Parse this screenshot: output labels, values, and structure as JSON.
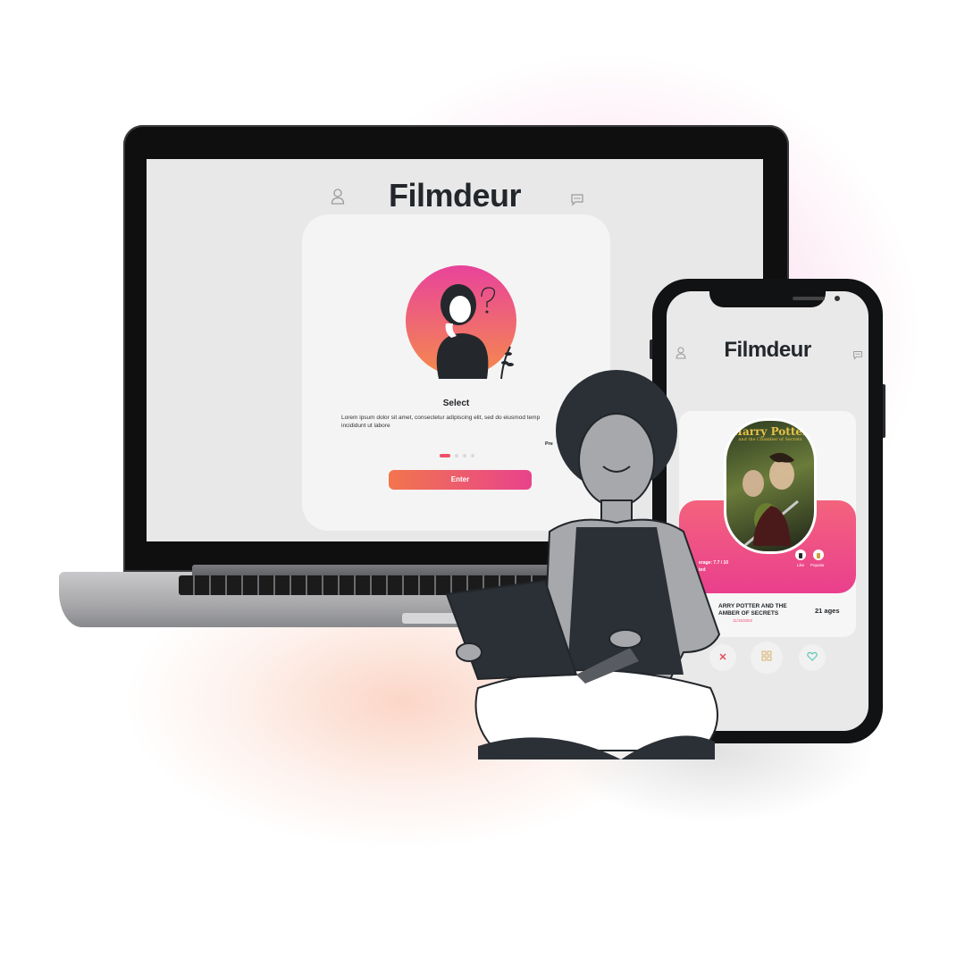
{
  "colors": {
    "accent_start": "#f2754e",
    "accent_end": "#e8438b",
    "dot_active": "#ef5066",
    "title_dark": "#23272b"
  },
  "laptop": {
    "app_title": "Filmdeur",
    "icons": {
      "left": "user-icon",
      "right": "chat-icon"
    },
    "card": {
      "heading": "Select",
      "body_line1": "Lorem ipsum dolor sit amet, consectetur adipiscing elit, sed do eiusmod temp",
      "body_line2": "incididunt ut labore",
      "prev_label": "Pre",
      "page_dots": {
        "count": 4,
        "active_index": 0
      },
      "enter_button": "Enter"
    }
  },
  "phone": {
    "app_title": "Filmdeur",
    "icons": {
      "left": "user-icon",
      "right": "chat-icon"
    },
    "movie_card": {
      "poster_title": "Harry Potter",
      "poster_subtitle": "and the Chamber of Secrets",
      "average_label": "erage: 7.7 / 10",
      "rated_label": "ted",
      "like_label": "Like",
      "popular_label": "Popular",
      "movie_title_line1": "ARRY POTTER AND THE",
      "movie_title_line2": "AMBER OF SECRETS",
      "release_date": "11/15/2002",
      "age_rating": "21 ages"
    },
    "actions": [
      "close-icon",
      "grid-icon",
      "heart-icon"
    ]
  }
}
